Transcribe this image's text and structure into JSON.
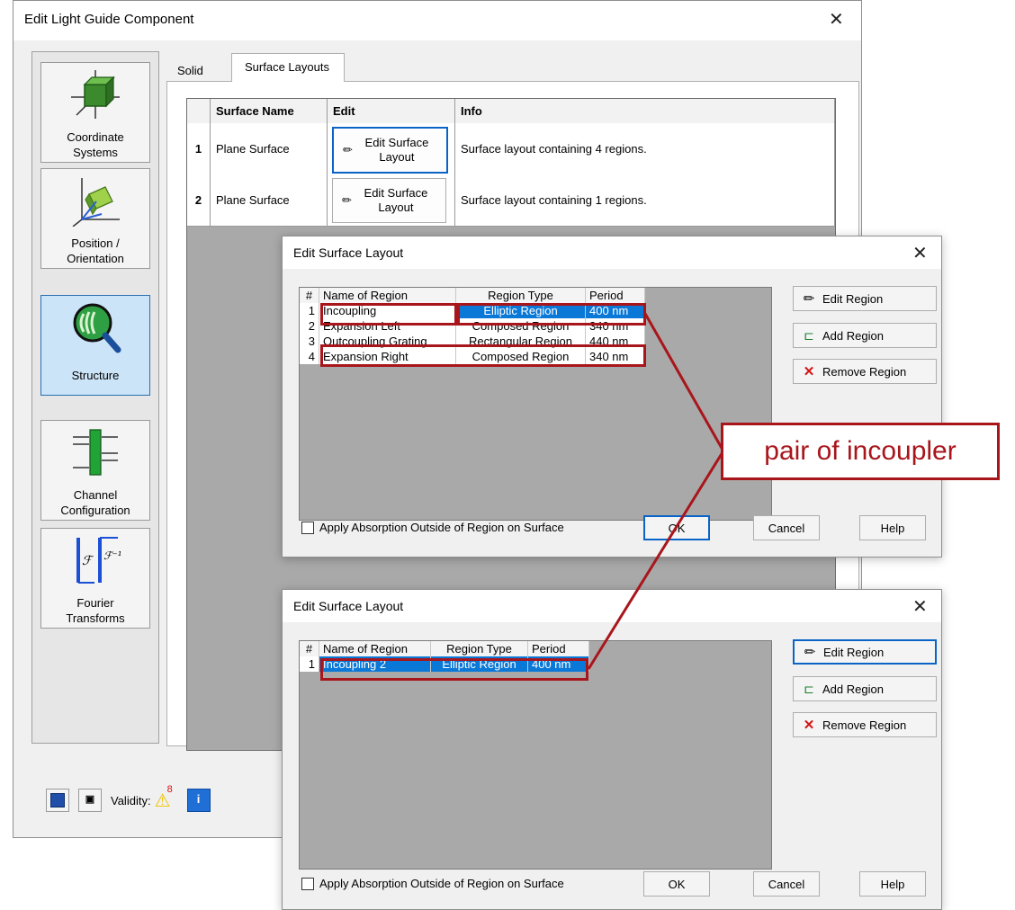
{
  "main_window": {
    "title": "Edit Light Guide Component",
    "nav": [
      {
        "label": "Coordinate\nSystems",
        "icon": "coordinate-systems-icon",
        "active": false
      },
      {
        "label": "Position /\nOrientation",
        "icon": "position-orientation-icon",
        "active": false
      },
      {
        "label": "Structure",
        "icon": "structure-icon",
        "active": true
      },
      {
        "label": "Channel\nConfiguration",
        "icon": "channel-configuration-icon",
        "active": false
      },
      {
        "label": "Fourier\nTransforms",
        "icon": "fourier-transforms-icon",
        "active": false
      }
    ],
    "tabs": [
      {
        "label": "Solid"
      },
      {
        "label": "Surface Layouts"
      }
    ],
    "surface_table": {
      "headers": [
        "",
        "Surface Name",
        "Edit",
        "Info"
      ],
      "rows": [
        {
          "num": "1",
          "name": "Plane Surface",
          "edit_label": "Edit Surface Layout",
          "info": "Surface layout containing 4 regions."
        },
        {
          "num": "2",
          "name": "Plane Surface",
          "edit_label": "Edit Surface Layout",
          "info": "Surface layout containing 1 regions."
        }
      ]
    },
    "validity_label": "Validity:",
    "validity_count": "8"
  },
  "dialog1": {
    "title": "Edit Surface Layout",
    "headers": [
      "#",
      "Name of Region",
      "Region Type",
      "Period"
    ],
    "rows": [
      {
        "num": "1",
        "name": "Incoupling",
        "type": "Elliptic Region",
        "period": "400 nm"
      },
      {
        "num": "2",
        "name": "Expansion Left",
        "type": "Composed Region",
        "period": "340 nm"
      },
      {
        "num": "3",
        "name": "Outcoupling Grating",
        "type": "Rectangular Region",
        "period": "440 nm"
      },
      {
        "num": "4",
        "name": "Expansion Right",
        "type": "Composed Region",
        "period": "340 nm"
      }
    ],
    "buttons": {
      "edit": "Edit Region",
      "add": "Add Region",
      "remove": "Remove Region"
    },
    "checkbox_label": "Apply Absorption Outside of Region on Surface",
    "ok": "OK",
    "cancel": "Cancel",
    "help": "Help"
  },
  "dialog2": {
    "title": "Edit Surface Layout",
    "headers": [
      "#",
      "Name of Region",
      "Region Type",
      "Period"
    ],
    "rows": [
      {
        "num": "1",
        "name": "Incoupling 2",
        "type": "Elliptic Region",
        "period": "400 nm"
      }
    ],
    "buttons": {
      "edit": "Edit Region",
      "add": "Add Region",
      "remove": "Remove Region"
    },
    "checkbox_label": "Apply Absorption Outside of Region on Surface",
    "ok": "OK",
    "cancel": "Cancel",
    "help": "Help"
  },
  "annotation": {
    "text": "pair of incoupler",
    "color": "#a8161c"
  },
  "colors": {
    "selection": "#0a78d7",
    "focus": "#0a64c8",
    "highlight": "#a8161c"
  }
}
